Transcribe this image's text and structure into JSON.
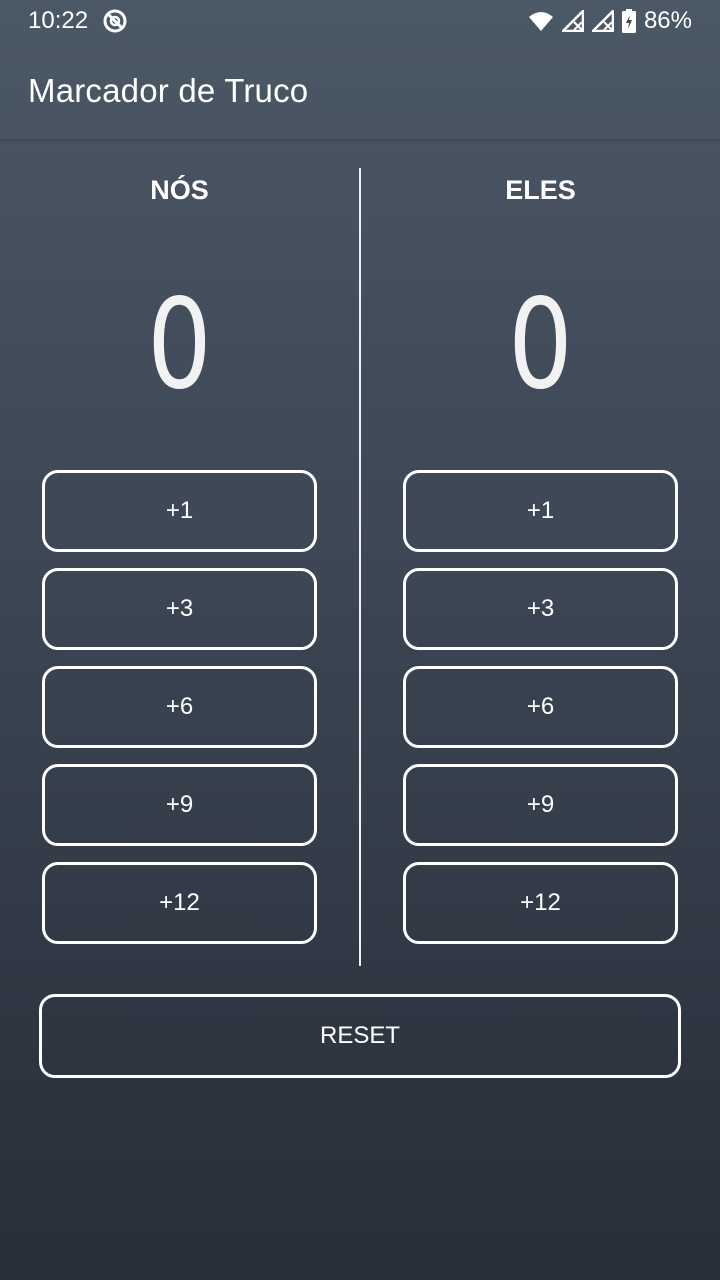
{
  "status_bar": {
    "time": "10:22",
    "battery": "86%",
    "icons": [
      "dnd-icon",
      "wifi-icon",
      "signal-icon",
      "signal-icon",
      "battery-icon"
    ]
  },
  "app_bar": {
    "title": "Marcador de Truco"
  },
  "teams": {
    "left": {
      "name": "NÓS",
      "score": "0",
      "buttons": [
        "+1",
        "+3",
        "+6",
        "+9",
        "+12"
      ]
    },
    "right": {
      "name": "ELES",
      "score": "0",
      "buttons": [
        "+1",
        "+3",
        "+6",
        "+9",
        "+12"
      ]
    }
  },
  "reset_label": "RESET",
  "colors": {
    "bg_top": "#4b5866",
    "bg_bottom": "#282e3a",
    "foreground": "#ffffff"
  }
}
